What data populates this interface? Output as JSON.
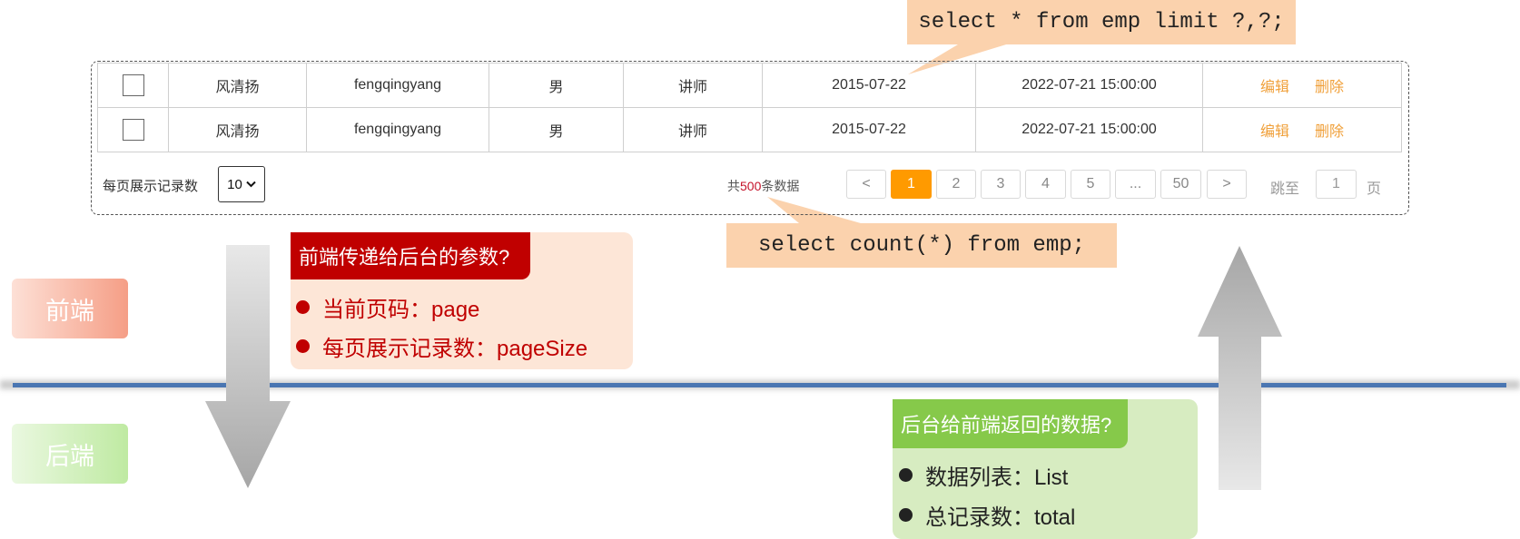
{
  "table": {
    "rows": [
      {
        "name": "风清扬",
        "username": "fengqingyang",
        "gender": "男",
        "job": "讲师",
        "entry_date": "2015-07-22",
        "update_time": "2022-07-21 15:00:00",
        "edit": "编辑",
        "delete": "删除"
      },
      {
        "name": "风清扬",
        "username": "fengqingyang",
        "gender": "男",
        "job": "讲师",
        "entry_date": "2015-07-22",
        "update_time": "2022-07-21 15:00:00",
        "edit": "编辑",
        "delete": "删除"
      }
    ]
  },
  "pagination": {
    "page_size_label": "每页展示记录数",
    "page_size_value": "10",
    "total_prefix": "共",
    "total_count": "500",
    "total_suffix": "条数据",
    "prev": "<",
    "pages": [
      "1",
      "2",
      "3",
      "4",
      "5",
      "...",
      "50"
    ],
    "active_page": "1",
    "next": ">",
    "jump_label": "跳至",
    "jump_value": "1",
    "page_suffix": "页"
  },
  "sql_limit": "select * from emp limit ?,?;",
  "sql_count": "select count(*) from emp;",
  "frontend_tag": "前端",
  "backend_tag": "后端",
  "frontend_box": {
    "title": "前端传递给后台的参数?",
    "items": [
      "当前页码：page",
      "每页展示记录数：pageSize"
    ]
  },
  "backend_box": {
    "title": "后台给前端返回的数据?",
    "items": [
      "数据列表：List",
      "总记录数：total"
    ]
  },
  "colors": {
    "accent_orange": "#ff9a00",
    "action_orange": "#f0a03a",
    "total_red": "#c4122a",
    "sql_bg": "#fbd2ad",
    "front_title_bg": "#c00000",
    "front_box_bg": "#fde6d7",
    "back_title_bg": "#86c94a",
    "back_box_bg": "#d7ecc1",
    "divider_blue": "#4a76b2"
  },
  "icons": {
    "checkbox": "checkbox-icon",
    "select": "chevron-down-icon",
    "down_arrow": "arrow-down-icon",
    "up_arrow": "arrow-up-icon"
  }
}
